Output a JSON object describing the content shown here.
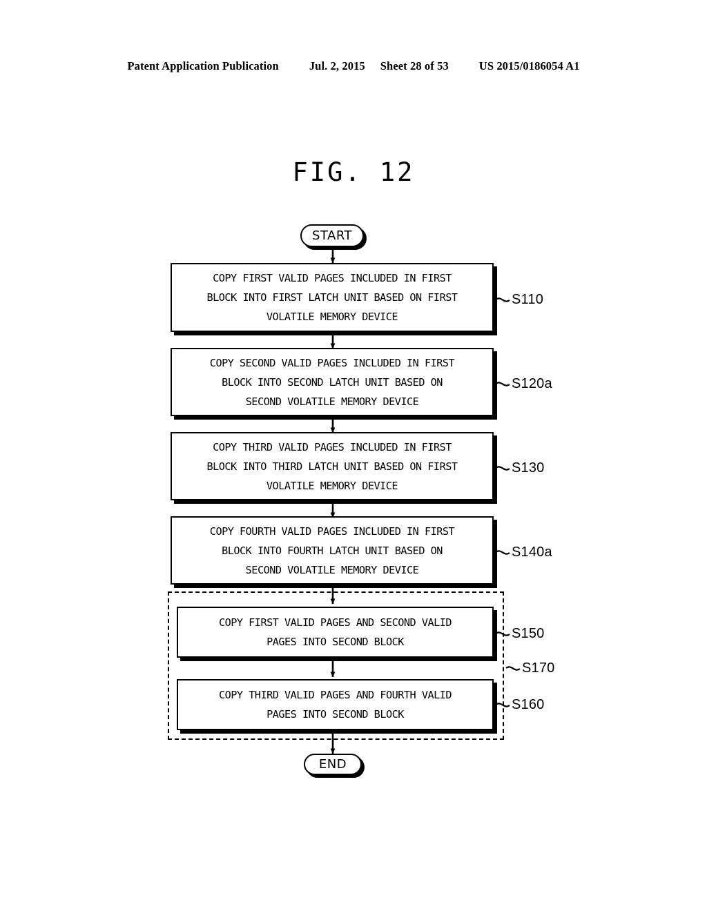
{
  "header": {
    "publication": "Patent Application Publication",
    "date": "Jul. 2, 2015",
    "sheet": "Sheet 28 of 53",
    "number": "US 2015/0186054 A1"
  },
  "figure": {
    "title": "FIG. 12"
  },
  "flowchart": {
    "start_label": "START",
    "end_label": "END",
    "steps": [
      {
        "id": "S110",
        "label": "S110",
        "lines": [
          "COPY FIRST VALID PAGES INCLUDED IN FIRST",
          "BLOCK INTO FIRST LATCH UNIT BASED ON FIRST",
          "VOLATILE MEMORY DEVICE"
        ]
      },
      {
        "id": "S120a",
        "label": "S120a",
        "lines": [
          "COPY SECOND VALID PAGES INCLUDED IN FIRST",
          "BLOCK INTO SECOND LATCH UNIT BASED ON",
          "SECOND VOLATILE MEMORY DEVICE"
        ]
      },
      {
        "id": "S130",
        "label": "S130",
        "lines": [
          "COPY THIRD VALID PAGES INCLUDED IN FIRST",
          "BLOCK INTO THIRD LATCH UNIT BASED ON FIRST",
          "VOLATILE MEMORY DEVICE"
        ]
      },
      {
        "id": "S140a",
        "label": "S140a",
        "lines": [
          "COPY FOURTH VALID PAGES INCLUDED IN FIRST",
          "BLOCK INTO FOURTH LATCH UNIT BASED ON",
          "SECOND VOLATILE MEMORY DEVICE"
        ]
      },
      {
        "id": "S150",
        "label": "S150",
        "lines": [
          "COPY FIRST VALID PAGES AND SECOND VALID",
          "PAGES INTO SECOND BLOCK"
        ]
      },
      {
        "id": "S160",
        "label": "S160",
        "lines": [
          "COPY THIRD VALID PAGES AND FOURTH VALID",
          "PAGES INTO SECOND BLOCK"
        ]
      }
    ],
    "group_label": "S170"
  },
  "colors": {
    "ink": "#000000",
    "paper": "#ffffff"
  }
}
